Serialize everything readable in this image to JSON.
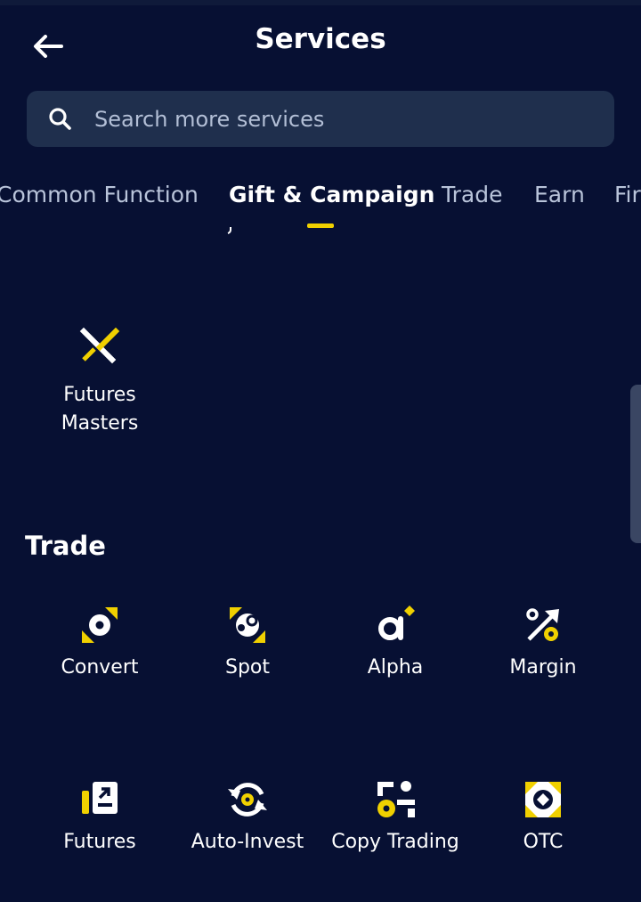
{
  "header": {
    "title": "Services"
  },
  "search": {
    "placeholder": "Search more services"
  },
  "tabs": [
    {
      "label": "Common Function"
    },
    {
      "label": "Gift & Campaign"
    },
    {
      "label": "Trade"
    },
    {
      "label": "Earn"
    },
    {
      "label": "Fir"
    }
  ],
  "active_tab": "Gift & Campaign",
  "gift_section": {
    "items": [
      {
        "label": "Futures\nMasters",
        "icon": "crossed-swords-icon"
      }
    ]
  },
  "trade_section": {
    "title": "Trade",
    "items": [
      {
        "label": "Convert",
        "icon": "convert-icon"
      },
      {
        "label": "Spot",
        "icon": "spot-icon"
      },
      {
        "label": "Alpha",
        "icon": "alpha-icon"
      },
      {
        "label": "Margin",
        "icon": "margin-icon"
      },
      {
        "label": "Futures",
        "icon": "futures-icon"
      },
      {
        "label": "Auto-Invest",
        "icon": "auto-invest-icon"
      },
      {
        "label": "Copy Trading",
        "icon": "copy-trading-icon"
      },
      {
        "label": "OTC",
        "icon": "otc-icon"
      }
    ]
  },
  "colors": {
    "background": "#071033",
    "accent": "#f0d000",
    "search_bg": "#1f2f4d",
    "tab_inactive": "#b9c4da"
  }
}
